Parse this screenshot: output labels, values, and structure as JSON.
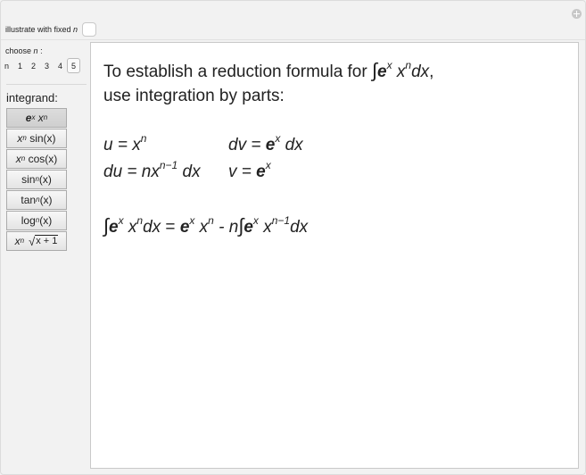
{
  "controls": {
    "fixed_label": "illustrate with fixed",
    "fixed_var": "n",
    "fixed_checked": false,
    "choose_label": "choose",
    "choose_var": "n",
    "choose_colon": " :",
    "n_prefix": "n",
    "n_options": [
      "1",
      "2",
      "3",
      "4",
      "5"
    ],
    "n_selected": "5",
    "integrand_label": "integrand:",
    "integrands": [
      {
        "base": "e",
        "rest": "x",
        "pow": "n",
        "selected": true
      },
      {
        "base": "x",
        "pow": "n",
        "rest": "sin(x)"
      },
      {
        "base": "x",
        "pow": "n",
        "rest": "cos(x)"
      },
      {
        "base": "sin",
        "pow": "n",
        "rest": "(x)"
      },
      {
        "base": "tan",
        "pow": "n",
        "rest": "(x)"
      },
      {
        "base": "log",
        "pow": "n",
        "rest": "(x)"
      },
      {
        "base": "x",
        "pow": "n",
        "rest": "x + 1"
      }
    ]
  },
  "main": {
    "intro_text": "To establish a reduction formula for",
    "intro_text2": "use integration by parts:",
    "u_def": "u = x",
    "u_pow": "n",
    "dv_def": "dv = ",
    "dv_tail": " dx",
    "du_def": "du = nx",
    "du_pow": "n−1",
    "du_tail": " dx",
    "v_def": "v = ",
    "formula_mid": " = ",
    "formula_minus": " - n",
    "dx": "dx",
    "e": "e",
    "x": "x",
    "n": "n",
    "n_minus_1": "n−1",
    "int_sign": "∫",
    "comma": ","
  }
}
